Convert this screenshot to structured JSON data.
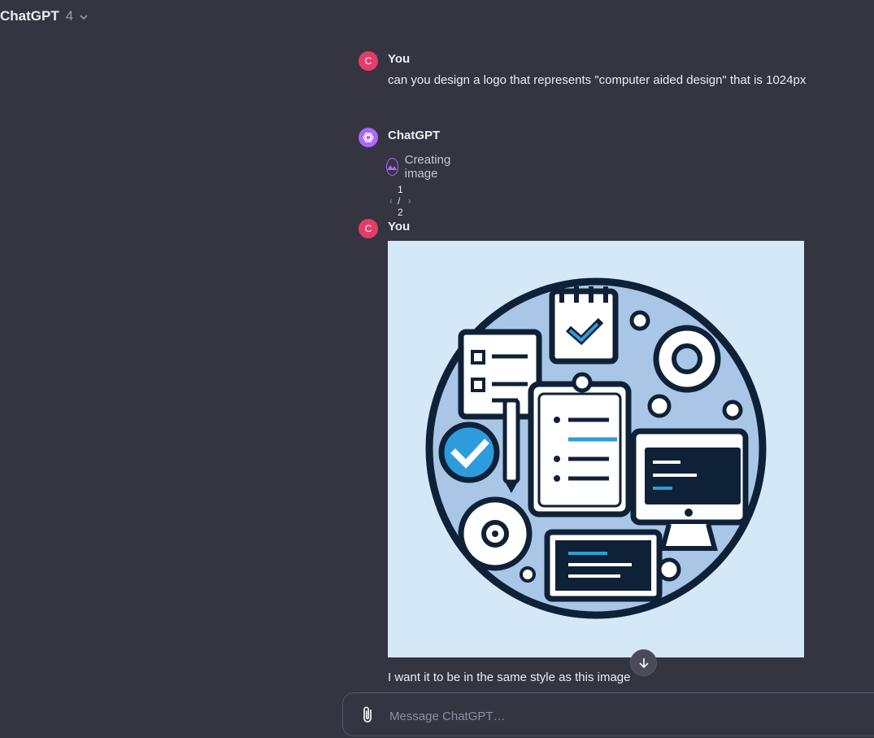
{
  "header": {
    "model_name": "ChatGPT",
    "model_version": "4"
  },
  "messages": [
    {
      "author": "You",
      "avatar_letter": "C",
      "text": "can you design a logo that represents \"computer aided design\" that is 1024px"
    },
    {
      "author": "ChatGPT",
      "status": "Creating image",
      "pager": "1 / 2"
    },
    {
      "author": "You",
      "avatar_letter": "C",
      "text": "I want it to be in the same style as this image",
      "image_icon": "cad-logo-image"
    }
  ],
  "composer": {
    "placeholder": "Message ChatGPT…"
  },
  "colors": {
    "background": "#343541",
    "user_avatar": "#e33d68",
    "assistant_avatar": "#ab68ff",
    "image_bg": "#d4e8f8"
  }
}
